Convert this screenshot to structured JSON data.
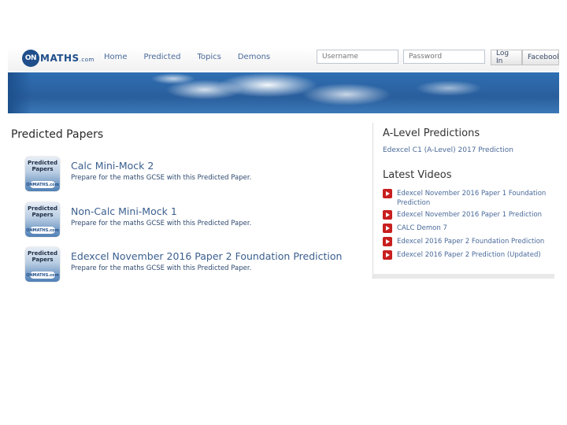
{
  "header": {
    "logo_on": "ON",
    "logo_text": "MATHS",
    "logo_suffix": ".com",
    "nav": [
      "Home",
      "Predicted",
      "Topics",
      "Demons"
    ],
    "username_placeholder": "Username",
    "password_placeholder": "Password",
    "login_label": "Log In",
    "facebook_label": "Facebook"
  },
  "main": {
    "title": "Predicted Papers",
    "thumb_text_line1": "Predicted",
    "thumb_text_line2": "Papers",
    "thumb_logo": "ONMATHS.com",
    "papers": [
      {
        "title": "Calc Mini-Mock 2",
        "desc": "Prepare for the maths GCSE with this Predicted Paper."
      },
      {
        "title": "Non-Calc Mini-Mock 1",
        "desc": "Prepare for the maths GCSE with this Predicted Paper."
      },
      {
        "title": "Edexcel November 2016 Paper 2 Foundation Prediction",
        "desc": "Prepare for the maths GCSE with this Predicted Paper."
      }
    ]
  },
  "sidebar": {
    "alevel_title": "A-Level Predictions",
    "alevel_link": "Edexcel C1 (A-Level) 2017 Prediction",
    "videos_title": "Latest Videos",
    "videos": [
      "Edexcel November 2016 Paper 1 Foundation Prediction",
      "Edexcel November 2016 Paper 1 Prediction",
      "CALC Demon 7",
      "Edexcel 2016 Paper 2 Foundation Prediction",
      "Edexcel 2016 Paper 2 Prediction (Updated)"
    ]
  }
}
